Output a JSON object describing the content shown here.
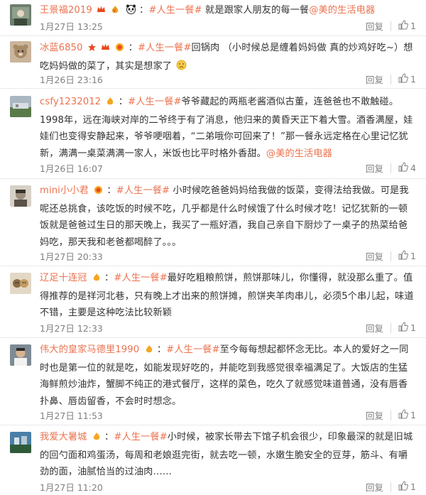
{
  "comments": [
    {
      "user": "王景福2019",
      "sep": "：",
      "topic": "#人生一餐#",
      "text": " 就是跟家人朋友的每一餐",
      "mention": "@美的生活电器",
      "text2": "",
      "time": "1月27日 13:25",
      "reply": "回复",
      "likes": "1"
    },
    {
      "user": "冰蓝6850",
      "sep": "：",
      "topic": "#人生一餐#",
      "text": "回锅肉 （小时候总是缠着妈妈做 真的炒鸡好吃~）想吃妈妈做的菜了，其实是想家了",
      "mention": "",
      "text2": "",
      "time": "1月26日 23:16",
      "reply": "回复",
      "likes": "1"
    },
    {
      "user": "csfy1232012",
      "sep": "：",
      "topic": "#人生一餐#",
      "text": "爷爷藏起的两瓶老酱酒似古董，连爸爸也不敢触碰。1998年，远在海峡对岸的二爷终于有了消息，他归来的黄昏天正下着大雪。酒香满屋，娃娃们也变得安静起来，爷爷哽咽着，“二弟哦你可回来了！”那一餐永远定格在心里记忆犹新，满满一桌菜满满一家人，米饭也比平时格外香甜。",
      "mention": "@美的生活电器",
      "text2": "",
      "time": "1月26日 16:07",
      "reply": "回复",
      "likes": "4"
    },
    {
      "user": "mini小小君",
      "sep": "：",
      "topic": "#人生一餐#",
      "text": " 小时候吃爸爸妈妈给我做的饭菜，变得法给我做。可是我呢还总挑食，该吃饭的时候不吃，几乎都是什么时候饿了什么时候才吃！记忆犹新的一顿饭就是爸爸过生日的那天晚上，我买了一瓶好酒，我自己亲自下厨炒了一桌子的热菜给爸妈吃，那天我和老爸都喝醉了。。。",
      "mention": "",
      "text2": "",
      "time": "1月27日 20:33",
      "reply": "回复",
      "likes": "1"
    },
    {
      "user": "辽足十连冠",
      "sep": "：",
      "topic": "#人生一餐#",
      "text": "最好吃粗粮煎饼，煎饼那味儿，你懂得，就没那么重了。值得推荐的是祥河北巷，只有晚上才出来的煎饼摊，煎饼夹羊肉串儿，必须5个串儿起，味道不错，主要是这种吃法比较新颖",
      "mention": "",
      "text2": "",
      "time": "1月27日 12:33",
      "reply": "回复",
      "likes": "1"
    },
    {
      "user": "伟大的皇家马德里1990",
      "sep": "：",
      "topic": "#人生一餐#",
      "text": "至今每每想起都怀念无比。本人的爱好之一同时也是第一位的就是吃，如能发现好吃的，并能吃到我感觉很幸福满足了。大饭店的生猛海鲜煎炒油炸，蟹脚不纯正的港式餐厅，这样的菜色，吃久了就感觉味道普通，没有唇香扑鼻、唇齿留香，不会时时想念。",
      "mention": "",
      "text2": "",
      "time": "1月27日 11:53",
      "reply": "回复",
      "likes": "1"
    },
    {
      "user": "我爱大暑城",
      "sep": "：",
      "topic": "#人生一餐#",
      "text": "小时候，被家长带去下馆子机会很少，印象最深的就是旧城的回勺面和鸡蛋汤，每周和老娘逛完街，就去吃一顿，水嫩生脆安全的豆芽，筋斗、有嚼劲的面，油腻恰当的过油肉……",
      "mention": "",
      "text2": "",
      "time": "1月27日 11:20",
      "reply": "回复",
      "likes": "1"
    }
  ],
  "colors": {
    "link": "#eb7350",
    "meta": "#808080",
    "text": "#333333",
    "divider": "#eaeaea"
  },
  "icons": {
    "reply": "reply-icon",
    "like": "thumbs-up-icon",
    "vip": "vip-crown-icon",
    "flame": "flame-badge-icon",
    "panda": "panda-emoji-icon",
    "sad": "sad-face-emoji-icon"
  }
}
